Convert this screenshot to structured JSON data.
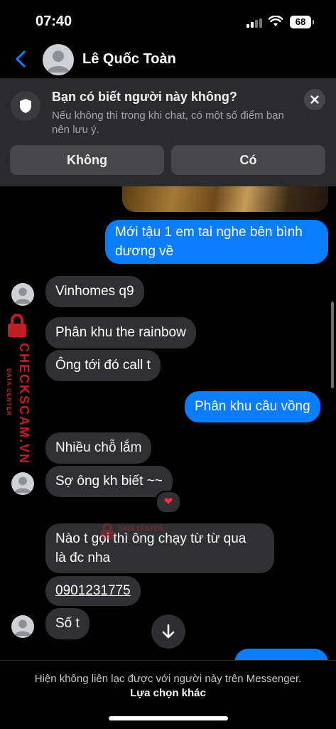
{
  "status_bar": {
    "time": "07:40",
    "battery": "68"
  },
  "header": {
    "contact_name": "Lê Quốc Toàn"
  },
  "notice": {
    "title": "Bạn có biết người này không?",
    "body": "Nếu không thì trong khi chat, có một số điểm bạn nên lưu ý.",
    "no_label": "Không",
    "yes_label": "Có"
  },
  "messages": [
    {
      "from": "me",
      "lines": [
        "Mới tậu 1 em tai nghe bên bình",
        "dương về"
      ]
    },
    {
      "from": "them",
      "text": "Vinhomes q9"
    },
    {
      "from": "them",
      "text": "Phân khu the rainbow"
    },
    {
      "from": "them",
      "text": "Ông tới đó call t"
    },
    {
      "from": "me",
      "text": "Phân khu cầu vồng"
    },
    {
      "from": "them",
      "text": "Nhiều chỗ lắm"
    },
    {
      "from": "them",
      "text": "Sợ ông kh biết ~~",
      "reaction": "❤"
    },
    {
      "from": "them",
      "lines": [
        "Nào t gọi thì ông chạy từ từ qua",
        "là đc nha"
      ]
    },
    {
      "from": "them",
      "text": "0901231775"
    },
    {
      "from": "them",
      "text": "Số t"
    }
  ],
  "watermark": {
    "brand": "CHECKSCAM.VN",
    "sub": "DATA CENTER"
  },
  "footer": {
    "notice": "Hiện không liên lạc được với người này trên Messenger.",
    "link": "Lựa chọn khác"
  },
  "colors": {
    "outgoing": "#0a7cff",
    "incoming": "#303033",
    "watermark": "#e0252f"
  }
}
